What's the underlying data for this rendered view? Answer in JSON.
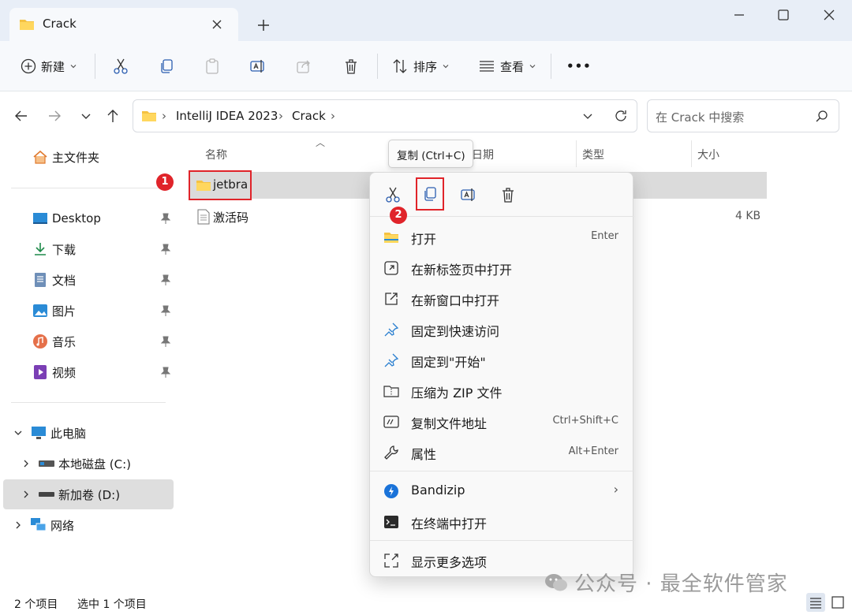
{
  "window": {
    "tab_title": "Crack"
  },
  "toolbar": {
    "new_label": "新建",
    "sort_label": "排序",
    "view_label": "查看",
    "more_label": "•••"
  },
  "address": {
    "crumbs": [
      "IntelliJ IDEA 2023",
      "Crack"
    ],
    "search_placeholder": "在 Crack 中搜索"
  },
  "sidebar": {
    "home": "主文件夹",
    "quick": [
      "Desktop",
      "下载",
      "文档",
      "图片",
      "音乐",
      "视频"
    ],
    "this_pc": "此电脑",
    "drives": [
      "本地磁盘 (C:)",
      "新加卷 (D:)"
    ],
    "network": "网络"
  },
  "columns": {
    "name": "名称",
    "date": "日期",
    "type": "类型",
    "size": "大小"
  },
  "files": [
    {
      "name": "jetbra",
      "size": ""
    },
    {
      "name": "激活码",
      "size": "4 KB"
    }
  ],
  "tooltip": "复制 (Ctrl+C)",
  "menu": {
    "items": [
      {
        "label": "打开",
        "shortcut": "Enter"
      },
      {
        "label": "在新标签页中打开",
        "shortcut": ""
      },
      {
        "label": "在新窗口中打开",
        "shortcut": ""
      },
      {
        "label": "固定到快速访问",
        "shortcut": ""
      },
      {
        "label": "固定到\"开始\"",
        "shortcut": ""
      },
      {
        "label": "压缩为 ZIP 文件",
        "shortcut": ""
      },
      {
        "label": "复制文件地址",
        "shortcut": "Ctrl+Shift+C"
      },
      {
        "label": "属性",
        "shortcut": "Alt+Enter"
      }
    ],
    "bandizip": "Bandizip",
    "terminal": "在终端中打开",
    "more": "显示更多选项"
  },
  "badges": [
    "1",
    "2"
  ],
  "status": {
    "count": "2 个项目",
    "selected": "选中 1 个项目"
  },
  "watermark": "公众号 · 最全软件管家",
  "colors": {
    "accent": "#0067c0",
    "folder": "#f5c242",
    "annotation_red": "#e0242a"
  }
}
